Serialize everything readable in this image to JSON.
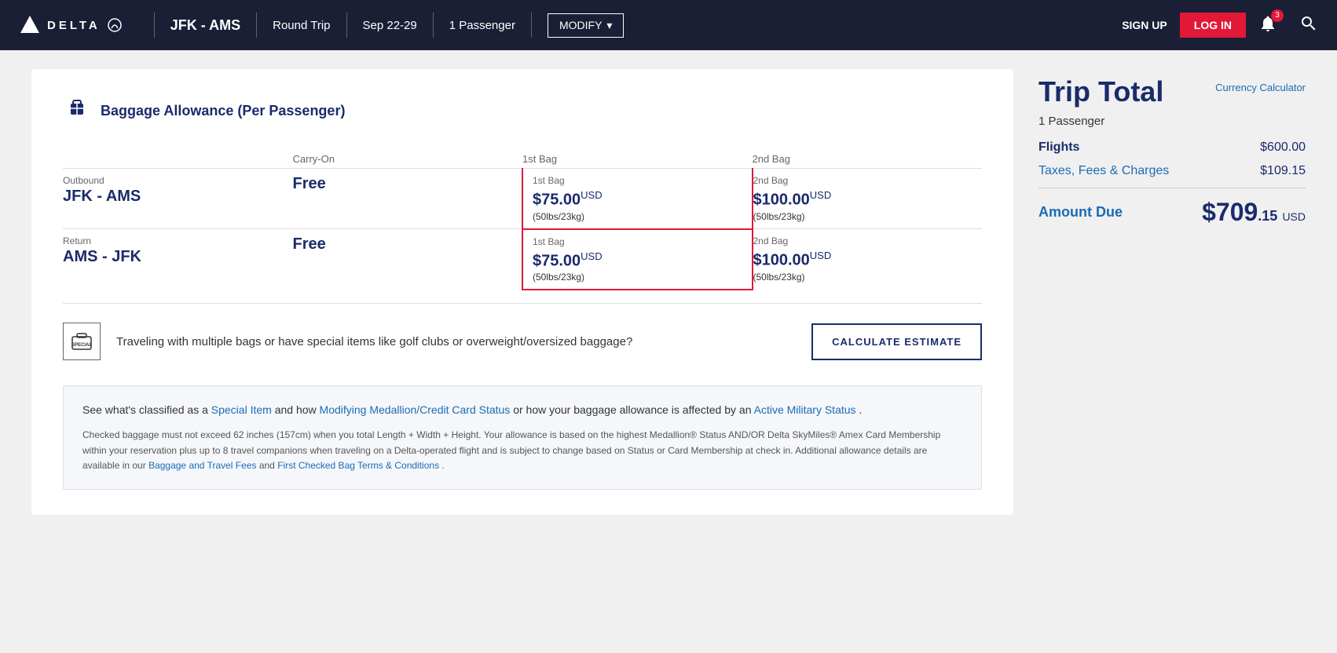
{
  "header": {
    "logo_text": "DELTA",
    "route": "JFK - AMS",
    "trip_type": "Round Trip",
    "dates": "Sep 22-29",
    "passengers": "1 Passenger",
    "modify_label": "MODIFY",
    "signup_label": "SIGN UP",
    "login_label": "LOG IN",
    "notification_count": "3"
  },
  "baggage": {
    "title": "Baggage Allowance (Per Passenger)",
    "outbound_label": "Outbound",
    "outbound_route": "JFK - AMS",
    "return_label": "Return",
    "return_route": "AMS - JFK",
    "carry_on_label": "Carry-On",
    "carry_on_outbound": "Free",
    "carry_on_return": "Free",
    "bag1_label": "1st Bag",
    "bag1_price": "$75.00",
    "bag1_currency": "USD",
    "bag1_weight": "(50lbs/23kg)",
    "bag2_label": "2nd Bag",
    "bag2_price": "$100.00",
    "bag2_currency": "USD",
    "bag2_weight": "(50lbs/23kg)",
    "return_bag1_label": "1st Bag",
    "return_bag1_price": "$75.00",
    "return_bag1_currency": "USD",
    "return_bag1_weight": "(50lbs/23kg)",
    "return_bag2_label": "2nd Bag",
    "return_bag2_price": "$100.00",
    "return_bag2_currency": "USD",
    "return_bag2_weight": "(50lbs/23kg)"
  },
  "estimate": {
    "text": "Traveling with multiple bags or have special items like golf clubs or overweight/oversized baggage?",
    "button_label": "CALCULATE ESTIMATE"
  },
  "info_box": {
    "main_text_pre": "See what's classified as a ",
    "special_item_link": "Special Item",
    "main_text_mid": " and how ",
    "medallion_link": "Modifying Medallion/Credit Card Status",
    "main_text_post": " or how your baggage allowance is affected by an ",
    "military_link": "Active Military Status",
    "main_text_end": " .",
    "detail": "Checked baggage must not exceed 62 inches (157cm) when you total Length + Width + Height. Your allowance is based on the highest Medallion® Status AND/OR Delta SkyMiles® Amex Card Membership within your reservation plus up to 8 travel companions when traveling on a Delta-operated flight and is subject to change based on Status or Card Membership at check in. Additional allowance details are available in our ",
    "baggage_fees_link": "Baggage and Travel Fees",
    "detail_mid": " and ",
    "first_bag_link": "First Checked Bag Terms & Conditions",
    "detail_end": " ."
  },
  "trip_total": {
    "title": "Trip Total",
    "currency_calc": "Currency Calculator",
    "passengers": "1 Passenger",
    "flights_label": "Flights",
    "flights_value": "$600.00",
    "taxes_label": "Taxes, Fees & Charges",
    "taxes_value": "$109.15",
    "amount_due_label": "Amount Due",
    "amount_whole": "$709",
    "amount_decimal": ".15",
    "amount_currency": "USD"
  }
}
